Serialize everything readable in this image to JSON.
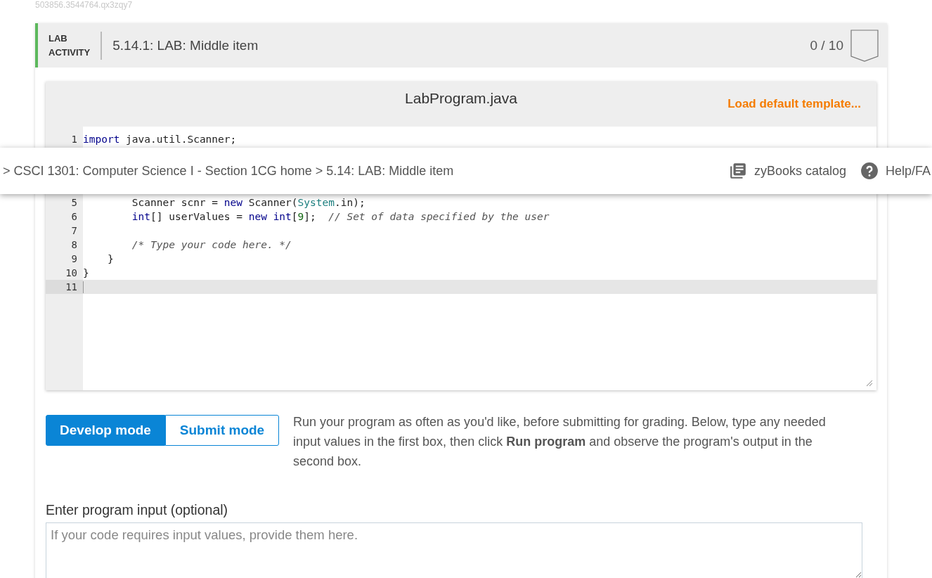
{
  "page_id": "503856.3544764.qx3zqy7",
  "activity": {
    "type_label": "LAB\nACTIVITY",
    "title": "5.14.1: LAB: Middle item",
    "score": "0 / 10"
  },
  "editor": {
    "filename": "LabProgram.java",
    "template_link": "Load default template...",
    "lines": [
      {
        "number": "1",
        "active": false,
        "tokens": [
          {
            "kind": "keyword",
            "text": "import"
          },
          {
            "kind": "plain",
            "text": " java.util.Scanner;"
          }
        ]
      },
      {
        "number": "5",
        "active": false,
        "tokens": [
          {
            "kind": "plain",
            "text": "        Scanner scnr = "
          },
          {
            "kind": "keyword",
            "text": "new"
          },
          {
            "kind": "plain",
            "text": " Scanner("
          },
          {
            "kind": "type",
            "text": "System"
          },
          {
            "kind": "plain",
            "text": ".in);"
          }
        ]
      },
      {
        "number": "6",
        "active": false,
        "tokens": [
          {
            "kind": "keyword",
            "text": "        int"
          },
          {
            "kind": "plain",
            "text": "[] userValues = "
          },
          {
            "kind": "keyword",
            "text": "new int"
          },
          {
            "kind": "plain",
            "text": "["
          },
          {
            "kind": "number",
            "text": "9"
          },
          {
            "kind": "plain",
            "text": "];  "
          },
          {
            "kind": "comment",
            "text": "// Set of data specified by the user"
          }
        ]
      },
      {
        "number": "7",
        "active": false
      },
      {
        "number": "8",
        "active": false,
        "tokens": [
          {
            "kind": "comment",
            "text": "        /* Type your code here. */"
          }
        ]
      },
      {
        "number": "9",
        "active": false,
        "tokens": [
          {
            "kind": "plain",
            "text": "    }"
          }
        ]
      },
      {
        "number": "10",
        "active": false,
        "tokens": [
          {
            "kind": "plain",
            "text": "}"
          }
        ]
      },
      {
        "number": "11",
        "active": true
      }
    ]
  },
  "modes": [
    {
      "label": "Develop mode",
      "selected": true
    },
    {
      "label": "Submit mode",
      "selected": false
    }
  ],
  "instructions": "Run your program as often as you'd like, before submitting for grading. Below, type any needed input values in the first box, then click **Run program** and observe the program's output in the second box.",
  "input": {
    "label": "Enter program input (optional)",
    "placeholder": "If your code requires input values, provide them here."
  },
  "breadcrumb": {
    "path": "> CSCI 1301: Computer Science I - Section 1CG home > 5.14: LAB: Middle item",
    "catalog": "zyBooks catalog",
    "help": "Help/FA"
  }
}
